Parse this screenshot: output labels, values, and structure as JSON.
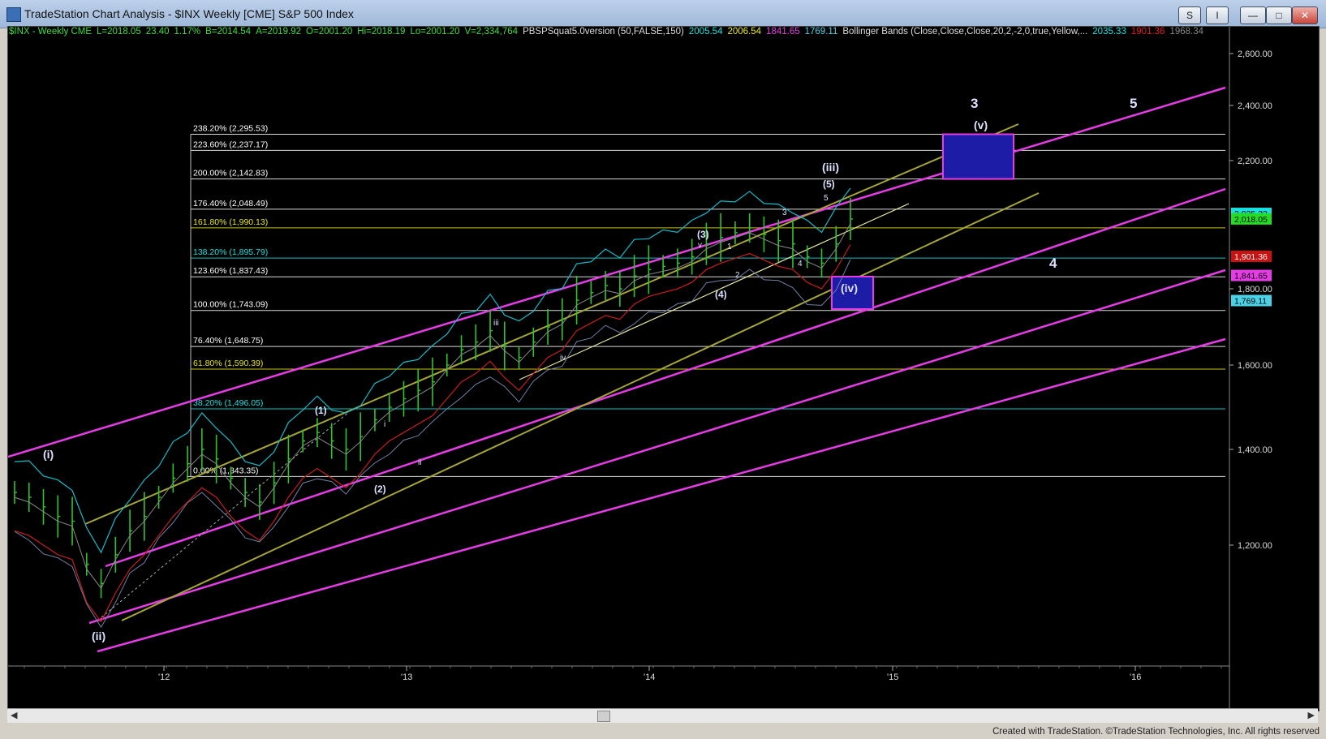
{
  "window": {
    "title": "TradeStation Chart Analysis - $INX Weekly [CME] S&P 500 Index",
    "buttons": {
      "s": "S",
      "i": "I",
      "min": "—",
      "max": "□",
      "close": "✕"
    }
  },
  "legend": [
    {
      "text": "$INX - Weekly  CME",
      "color": "#3ddc3d"
    },
    {
      "text": "L=2018.05",
      "color": "#3ddc3d"
    },
    {
      "text": "23.40",
      "color": "#3ddc3d"
    },
    {
      "text": "1.17%",
      "color": "#3ddc3d"
    },
    {
      "text": "B=2014.54",
      "color": "#3ddc3d"
    },
    {
      "text": "A=2019.92",
      "color": "#3ddc3d"
    },
    {
      "text": "O=2001.20",
      "color": "#3ddc3d"
    },
    {
      "text": "Hi=2018.19",
      "color": "#3ddc3d"
    },
    {
      "text": "Lo=2001.20",
      "color": "#3ddc3d"
    },
    {
      "text": "V=2,334,764",
      "color": "#3ddc3d"
    },
    {
      "text": "PBSPSquat5.0version (50,FALSE,150)",
      "color": "#dddddd"
    },
    {
      "text": "2005.54",
      "color": "#19e0e0"
    },
    {
      "text": "2006.54",
      "color": "#e6e61e"
    },
    {
      "text": "1841.65",
      "color": "#e63ce6"
    },
    {
      "text": "1769.11",
      "color": "#4bd2e6"
    },
    {
      "text": "Bollinger Bands (Close,Close,Close,20,2,-2,0,true,Yellow,...",
      "color": "#dddddd"
    },
    {
      "text": "2035.33",
      "color": "#19e0e0"
    },
    {
      "text": "1901.36",
      "color": "#e02020"
    },
    {
      "text": "1968.34",
      "color": "#888888"
    }
  ],
  "chart_data": {
    "type": "line",
    "title": "$INX Weekly",
    "y_axis": {
      "ticks": [
        "2,600.00",
        "2,400.00",
        "2,200.00",
        "1,400.00",
        "1,600.00",
        "1,800.00",
        "1,200.00"
      ],
      "tick_values": [
        2600,
        2400,
        2200,
        1400,
        1600,
        1800,
        1200
      ]
    },
    "x_axis": {
      "ticks": [
        "'12",
        "'13",
        "'14",
        "'15",
        "'16"
      ]
    },
    "price_tags": [
      {
        "text": "2,035.33",
        "value": 2035.33,
        "bg": "#19e0e0",
        "color": "#000000"
      },
      {
        "text": "2,018.05",
        "value": 2018.05,
        "bg": "#22dd22",
        "color": "#000000"
      },
      {
        "text": "1,901.36",
        "value": 1901.36,
        "bg": "#cc1111",
        "color": "#ffffff"
      },
      {
        "text": "1,841.65",
        "value": 1841.65,
        "bg": "#e63ce6",
        "color": "#000000"
      },
      {
        "text": "1,769.11",
        "value": 1769.11,
        "bg": "#4bd2e6",
        "color": "#000000"
      }
    ],
    "fib_levels": [
      {
        "label": "238.20% (2,295.53)",
        "value": 2295.53,
        "color": "#ffffff"
      },
      {
        "label": "223.60% (2,237.17)",
        "value": 2237.17,
        "color": "#ffffff"
      },
      {
        "label": "200.00% (2,142.83)",
        "value": 2142.83,
        "color": "#ffffff"
      },
      {
        "label": "176.40% (2,048.49)",
        "value": 2048.49,
        "color": "#ffffff"
      },
      {
        "label": "161.80% (1,990.13)",
        "value": 1990.13,
        "color": "#e6e61e"
      },
      {
        "label": "138.20% (1,895.79)",
        "value": 1895.79,
        "color": "#19e0e0"
      },
      {
        "label": "123.60% (1,837.43)",
        "value": 1837.43,
        "color": "#ffffff"
      },
      {
        "label": "100.00% (1,743.09)",
        "value": 1743.09,
        "color": "#ffffff"
      },
      {
        "label": "76.40% (1,648.75)",
        "value": 1648.75,
        "color": "#ffffff"
      },
      {
        "label": "61.80% (1,590.39)",
        "value": 1590.39,
        "color": "#e6e61e"
      },
      {
        "label": "38.20% (1,496.05)",
        "value": 1496.05,
        "color": "#19e0e0"
      },
      {
        "label": "0.00% (1,343.35)",
        "value": 1343.35,
        "color": "#ffffff"
      }
    ],
    "wave_labels": [
      {
        "text": "(i)",
        "size": "large"
      },
      {
        "text": "(ii)",
        "size": "large"
      },
      {
        "text": "(1)",
        "size": "med"
      },
      {
        "text": "(2)",
        "size": "med"
      },
      {
        "text": "(3)",
        "size": "med"
      },
      {
        "text": "(4)",
        "size": "med"
      },
      {
        "text": "(5)",
        "size": "med"
      },
      {
        "text": "(iii)",
        "size": "large"
      },
      {
        "text": "(iv)",
        "size": "large"
      },
      {
        "text": "(v)",
        "size": "large"
      },
      {
        "text": "3",
        "size": "xl"
      },
      {
        "text": "4",
        "size": "xl"
      },
      {
        "text": "5",
        "size": "xl"
      },
      {
        "text": "iii",
        "size": "small"
      },
      {
        "text": "iv",
        "size": "small"
      },
      {
        "text": "v",
        "size": "small"
      },
      {
        "text": "i",
        "size": "small"
      },
      {
        "text": "ii",
        "size": "small"
      },
      {
        "text": "1",
        "size": "small"
      },
      {
        "text": "2",
        "size": "small"
      },
      {
        "text": "3",
        "size": "small"
      },
      {
        "text": "4",
        "size": "small"
      },
      {
        "text": "5",
        "size": "small"
      }
    ],
    "series": [
      {
        "name": "price",
        "values": [
          1310,
          1300,
          1280,
          1260,
          1250,
          1160,
          1120,
          1180,
          1230,
          1260,
          1300,
          1340,
          1370,
          1400,
          1380,
          1340,
          1310,
          1290,
          1330,
          1380,
          1420,
          1440,
          1420,
          1400,
          1430,
          1470,
          1500,
          1520,
          1540,
          1560,
          1600,
          1640,
          1660,
          1690,
          1650,
          1620,
          1660,
          1700,
          1720,
          1770,
          1790,
          1810,
          1800,
          1840,
          1860,
          1870,
          1880,
          1900,
          1940,
          1960,
          1975,
          1990,
          1970,
          1950,
          1940,
          1900,
          1880,
          1940,
          2018
        ]
      }
    ]
  },
  "footer": "Created with TradeStation. ©TradeStation Technologies, Inc. All rights reserved"
}
